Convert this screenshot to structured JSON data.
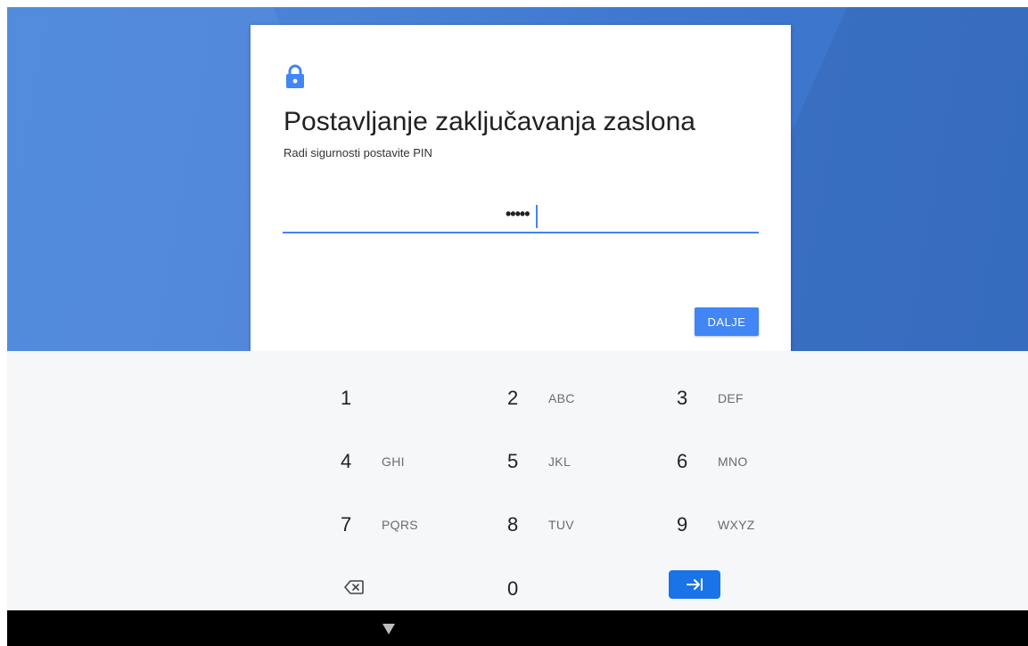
{
  "setup": {
    "title": "Postavljanje zaključavanja zaslona",
    "subtitle": "Radi sigurnosti postavite PIN",
    "pin_masked": "•••••",
    "next_label": "DALJE"
  },
  "keypad": {
    "keys": [
      {
        "digit": "1",
        "letters": ""
      },
      {
        "digit": "2",
        "letters": "ABC"
      },
      {
        "digit": "3",
        "letters": "DEF"
      },
      {
        "digit": "4",
        "letters": "GHI"
      },
      {
        "digit": "5",
        "letters": "JKL"
      },
      {
        "digit": "6",
        "letters": "MNO"
      },
      {
        "digit": "7",
        "letters": "PQRS"
      },
      {
        "digit": "8",
        "letters": "TUV"
      },
      {
        "digit": "9",
        "letters": "WXYZ"
      },
      {
        "digit": "0",
        "letters": ""
      }
    ],
    "backspace_icon": "backspace-icon",
    "tab_icon": "tab-next-icon"
  },
  "nav": {
    "back_icon": "back-triangle-icon"
  },
  "colors": {
    "accent": "#4285f4",
    "wallpaper": "#4a82d6",
    "keypad_bg": "#f6f7f9"
  }
}
